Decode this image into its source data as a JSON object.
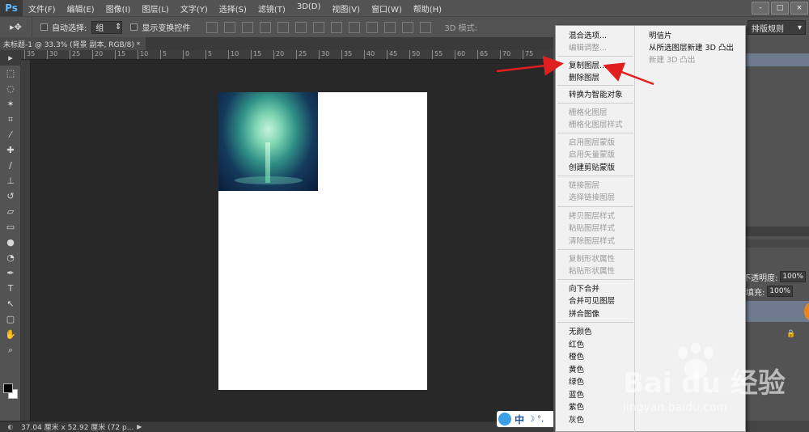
{
  "app": {
    "logo": "Ps",
    "menus": [
      "文件(F)",
      "编辑(E)",
      "图像(I)",
      "图层(L)",
      "文字(Y)",
      "选择(S)",
      "滤镜(T)",
      "3D(D)",
      "视图(V)",
      "窗口(W)",
      "帮助(H)"
    ],
    "window_controls": [
      "-",
      "□",
      "×"
    ]
  },
  "options": {
    "auto_select_label": "自动选择:",
    "auto_select_value": "组",
    "show_transform_label": "显示变换控件",
    "mode_3d_label": "3D 模式:",
    "workspace": "排版规则"
  },
  "document": {
    "tab_title": "未标题-1 @ 33.3% (背景 副本, RGB/8) *",
    "tab_close": "×",
    "ruler_ticks": [
      "35",
      "30",
      "25",
      "20",
      "15",
      "10",
      "5",
      "0",
      "5",
      "10",
      "15",
      "20",
      "25",
      "30",
      "35",
      "40",
      "45",
      "50",
      "55",
      "60",
      "65",
      "70",
      "75"
    ]
  },
  "tools": [
    "move",
    "marquee",
    "lasso",
    "magic-wand",
    "crop",
    "eyedropper",
    "healing",
    "brush",
    "stamp",
    "history-brush",
    "eraser",
    "gradient",
    "blur",
    "dodge",
    "pen",
    "type",
    "path-select",
    "shape",
    "hand",
    "zoom"
  ],
  "status": {
    "info": "37.04 厘米 x 52.92 厘米 (72 p...",
    "arrow": "▶"
  },
  "ime": {
    "lang": "中",
    "moon": "☽",
    "dot": "°,"
  },
  "panels": {
    "opacity_label": "不透明度:",
    "opacity_value": "100%",
    "fill_label": "填充:",
    "fill_value": "100%"
  },
  "context_menu": {
    "col1": [
      {
        "label": "混合选项...",
        "enabled": true
      },
      {
        "label": "编辑调整...",
        "enabled": false
      },
      {
        "label": "复制图层...",
        "enabled": true
      },
      {
        "label": "删除图层",
        "enabled": true
      },
      {
        "label": "转换为智能对象",
        "enabled": true
      },
      {
        "label": "栅格化图层",
        "enabled": false
      },
      {
        "label": "栅格化图层样式",
        "enabled": false
      },
      {
        "label": "启用图层蒙版",
        "enabled": false
      },
      {
        "label": "启用矢量蒙版",
        "enabled": false
      },
      {
        "label": "创建剪贴蒙版",
        "enabled": true
      },
      {
        "label": "链接图层",
        "enabled": false
      },
      {
        "label": "选择链接图层",
        "enabled": false
      },
      {
        "label": "拷贝图层样式",
        "enabled": false
      },
      {
        "label": "粘贴图层样式",
        "enabled": false
      },
      {
        "label": "清除图层样式",
        "enabled": false
      },
      {
        "label": "复制形状属性",
        "enabled": false
      },
      {
        "label": "粘贴形状属性",
        "enabled": false
      },
      {
        "label": "向下合并",
        "enabled": true
      },
      {
        "label": "合并可见图层",
        "enabled": true
      },
      {
        "label": "拼合图像",
        "enabled": true
      },
      {
        "label": "无颜色",
        "enabled": true
      },
      {
        "label": "红色",
        "enabled": true
      },
      {
        "label": "橙色",
        "enabled": true
      },
      {
        "label": "黄色",
        "enabled": true
      },
      {
        "label": "绿色",
        "enabled": true
      },
      {
        "label": "蓝色",
        "enabled": true
      },
      {
        "label": "紫色",
        "enabled": true
      },
      {
        "label": "灰色",
        "enabled": true
      }
    ],
    "col2": [
      {
        "label": "明信片",
        "enabled": true
      },
      {
        "label": "从所选图层新建 3D 凸出",
        "enabled": true
      },
      {
        "label": "新建 3D 凸出",
        "enabled": false
      }
    ]
  },
  "watermark": {
    "brand": "Bai du 经验",
    "url": "jingyan.baidu.com"
  },
  "colors": {
    "annotation_arrow": "#e0201e",
    "selected_layer": "#6e7b8f",
    "menu_bg": "#f1f1f1"
  }
}
